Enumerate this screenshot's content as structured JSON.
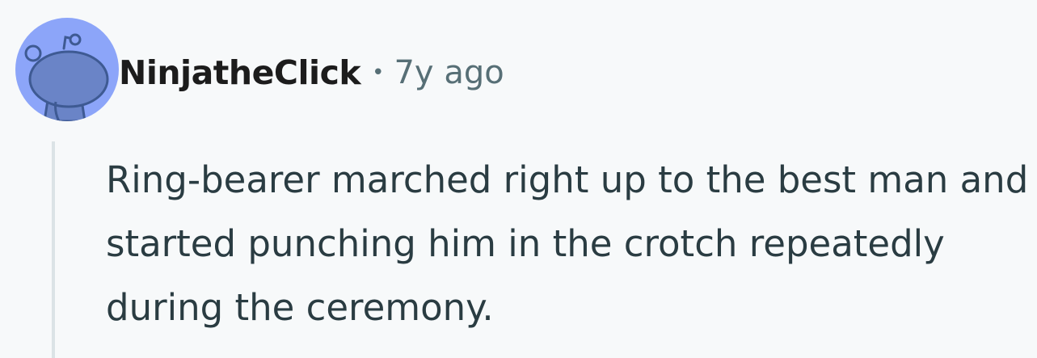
{
  "comment": {
    "avatar_icon": "reddit-snoo-default-avatar-icon",
    "avatar_bg": "#8ca5f9",
    "username": "NinjatheClick",
    "separator": "•",
    "timestamp": "7y ago",
    "body": "Ring-bearer marched right up to the best man and started punching him in the crotch repeatedly during the ceremony."
  },
  "colors": {
    "page_bg": "#f7f9fa",
    "username": "#1c1c1c",
    "meta_text": "#576f76",
    "body_text": "#2a3c42",
    "thread_line": "#dbe3e6"
  }
}
